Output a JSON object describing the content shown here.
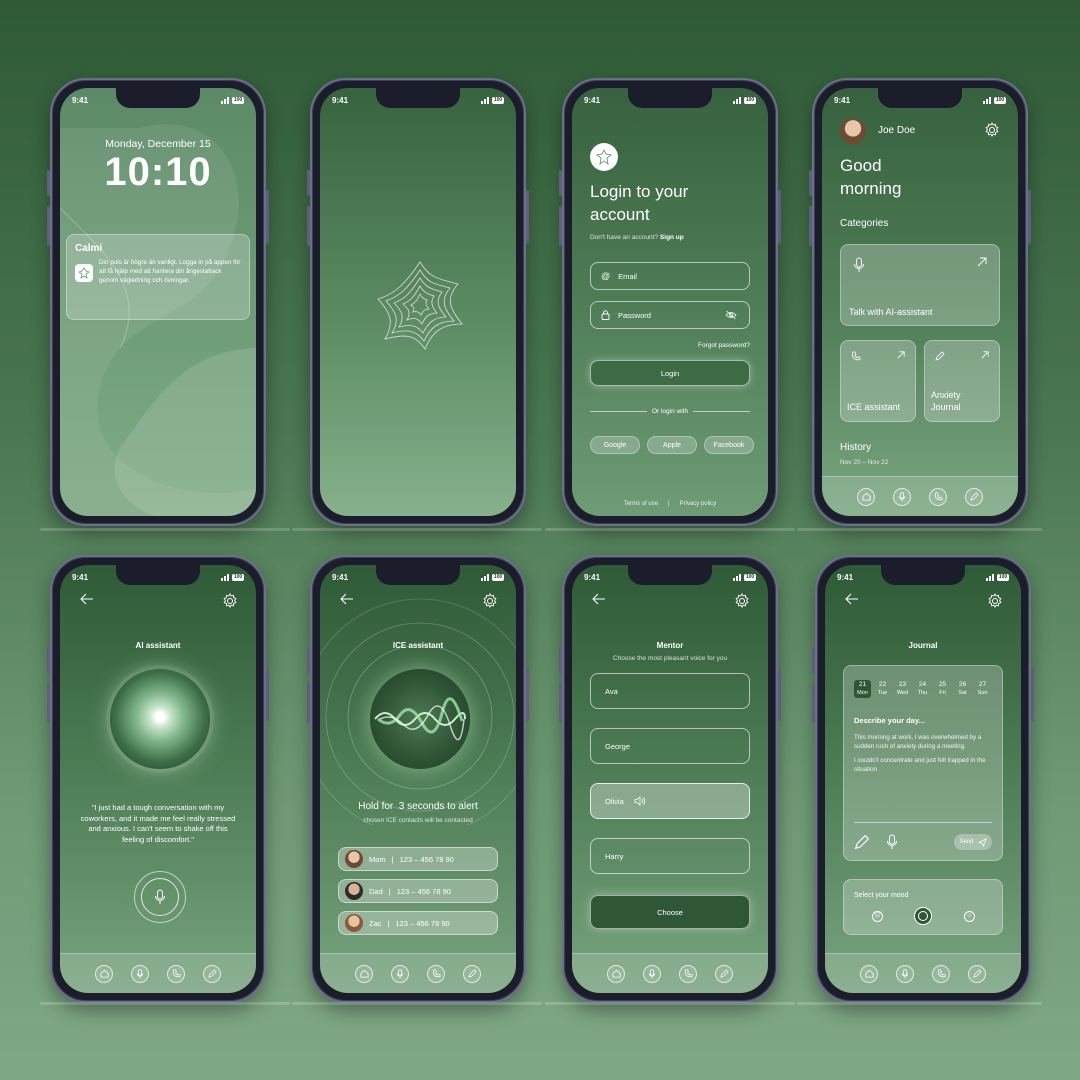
{
  "status": {
    "time": "9:41",
    "battery": "100"
  },
  "lock": {
    "date": "Monday, December 15",
    "time": "10:10",
    "notification": {
      "app": "Calmi",
      "text": "Din puls är högre än vanligt. Logga in på appen för att få hjälp med att hantera din ångestattack genom vägledning och övningar."
    }
  },
  "login": {
    "title": "Login to your account",
    "prompt": "Don't have an account?",
    "signup": "Sign up",
    "email_placeholder": "Email",
    "password_placeholder": "Password",
    "forgot": "Forgot password?",
    "login_button": "Login",
    "or": "Or login with",
    "providers": [
      "Google",
      "Apple",
      "Facebook"
    ],
    "terms": "Terms of use",
    "privacy": "Privacy policy"
  },
  "home": {
    "user": "Joe Doe",
    "greeting": "Good morning",
    "categories_label": "Categories",
    "card_ai": "Talk with AI-assistant",
    "card_ice": "ICE assistant",
    "card_journal": "Anxiety Journal",
    "history_label": "History",
    "history_range": "Nov 20 – Nov 22"
  },
  "ai": {
    "title": "AI assistant",
    "quote": "\"I just had a tough conversation with my coworkers, and it made me feel really stressed and anxious. I can't seem to shake off this feeling of discomfort.\""
  },
  "ice": {
    "title": "ICE assistant",
    "hold_text": "Hold for  3 seconds to alert",
    "sub": "chosen ICE contacts will be contacted",
    "contacts": [
      {
        "name": "Mom",
        "phone": "123 – 456 78 90"
      },
      {
        "name": "Dad",
        "phone": "123 – 456 78 90"
      },
      {
        "name": "Zac",
        "phone": "123 – 456 78 90"
      }
    ]
  },
  "mentor": {
    "title": "Mentor",
    "sub": "Choose the most pleasant voice for you",
    "voices": [
      "Ava",
      "George",
      "Olivia",
      "Harry"
    ],
    "selected": "Olivia",
    "choose_button": "Choose"
  },
  "journal": {
    "title": "Journal",
    "days": [
      {
        "num": "21",
        "day": "Mon"
      },
      {
        "num": "22",
        "day": "Tue"
      },
      {
        "num": "23",
        "day": "Wed"
      },
      {
        "num": "24",
        "day": "Thu"
      },
      {
        "num": "25",
        "day": "Fri"
      },
      {
        "num": "26",
        "day": "Sat"
      },
      {
        "num": "27",
        "day": "Sun"
      }
    ],
    "prompt": "Describe your day...",
    "entry1": "This morning at work, I was overwhelmed by a sudden rush of anxiety during a meeting.",
    "entry2": "I couldn't concentrate and just felt trapped in the situation",
    "send": "Send",
    "mood_label": "Select your mood"
  },
  "colors": {
    "accent_dark": "#2f5637",
    "glass": "rgba(255,255,255,0.16)"
  }
}
